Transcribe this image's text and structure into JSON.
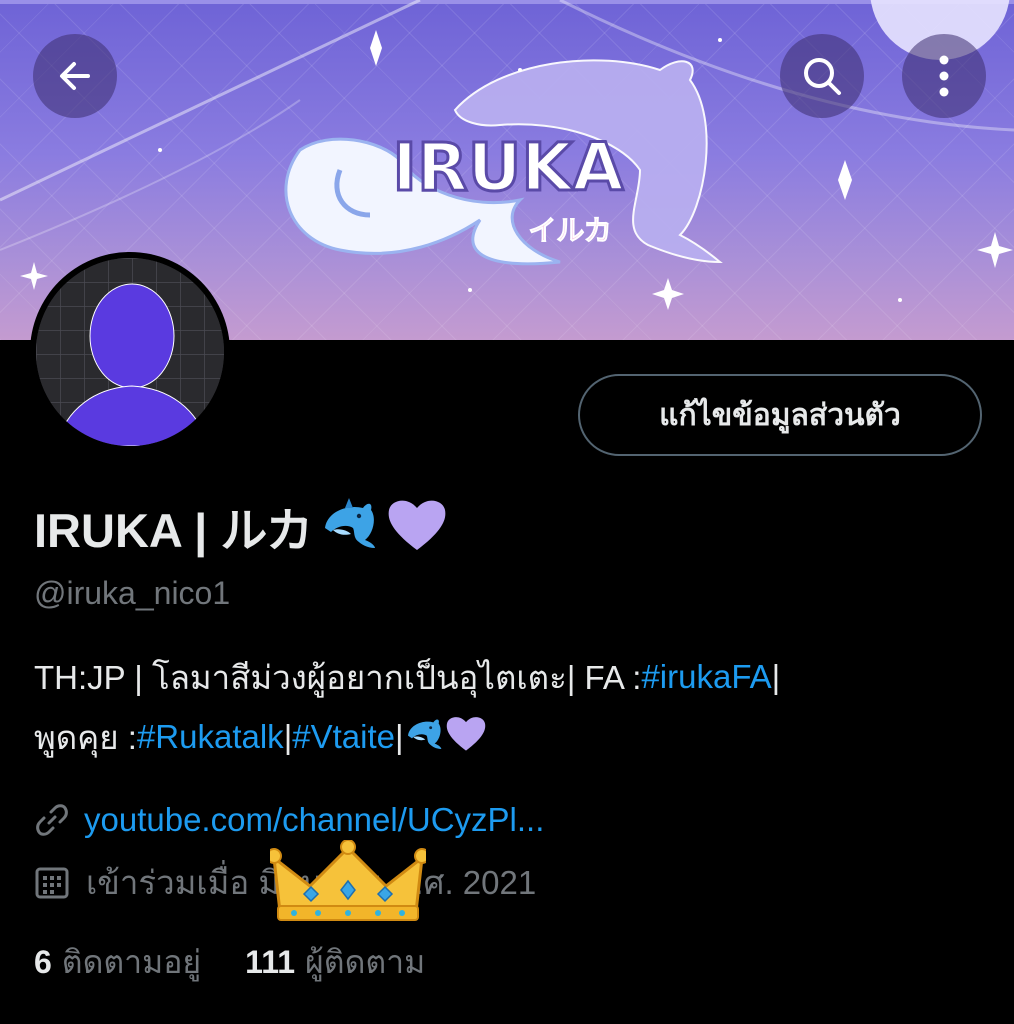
{
  "header": {
    "banner_logo_text": "IRUKA",
    "banner_logo_subtext": "イルカ"
  },
  "profile": {
    "edit_button_label": "แก้ไขข้อมูลส่วนตัว",
    "display_name": "IRUKA | ルカ",
    "handle": "@iruka_nico1",
    "bio": {
      "line1_text": "TH:JP | โลมาสีม่วงผู้อยากเป็นอุไตเตะ| FA : ",
      "line1_hashtag": "#irukaFA",
      "line1_end": " |",
      "line2_text": "พูดคุย : ",
      "line2_hashtag1": "#Rukatalk",
      "line2_sep": " | ",
      "line2_hashtag2": "#Vtaite",
      "line2_end": " |"
    },
    "website": "youtube.com/channel/UCyzPl...",
    "joined": "เข้าร่วมเมื่อ มิถุนายน ค.ศ. 2021",
    "following_count": "6",
    "following_label": "ติดตามอยู่",
    "followers_count": "111",
    "followers_label": "ผู้ติดตาม"
  },
  "icons": {
    "back": "arrow-left-icon",
    "search": "search-icon",
    "more": "more-vertical-icon",
    "link": "link-icon",
    "calendar": "calendar-icon",
    "dolphin": "dolphin-emoji",
    "heart": "purple-heart-emoji",
    "crown": "crown-sticker"
  },
  "colors": {
    "background": "#000000",
    "text_primary": "#e7e9ea",
    "text_secondary": "#71767b",
    "link": "#1d9bf0",
    "accent_purple": "#b9a4f2"
  }
}
